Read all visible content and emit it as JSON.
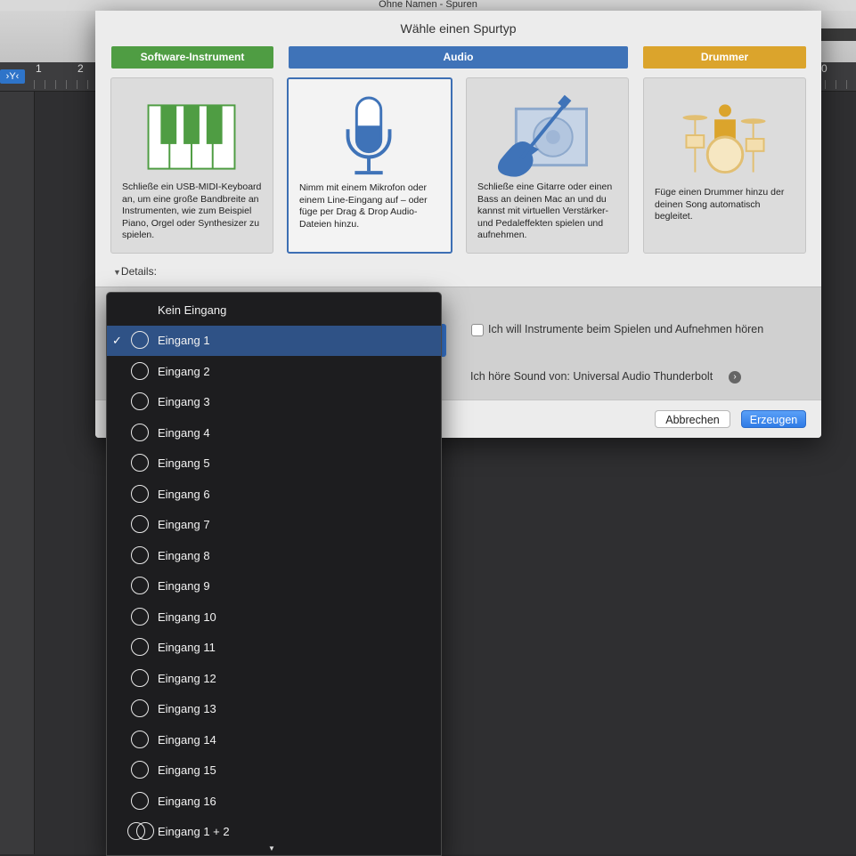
{
  "window": {
    "title": "Ohne Namen - Spuren"
  },
  "ruler": {
    "marks": [
      "1",
      "2",
      "0"
    ],
    "filter_button": "›Y‹"
  },
  "dialog": {
    "title": "Wähle einen Spurtyp",
    "categories": [
      {
        "label": "Software-Instrument",
        "color": "#4f9d43",
        "description": "Schließe ein USB-MIDI-Keyboard an, um eine große Bandbreite an Instrumenten, wie zum Beispiel Piano, Orgel oder Synthesizer zu spielen."
      },
      {
        "label": "Audio",
        "color": "#3f73b8",
        "description": "Nimm mit einem Mikrofon oder einem Line-Eingang auf – oder füge per Drag & Drop Audio-Dateien hinzu."
      },
      {
        "label": "",
        "color": "#3f73b8",
        "description": "Schließe eine Gitarre oder einen Bass an deinen Mac an und du kannst mit virtuellen Verstärker-und Pedaleffekten spielen und aufnehmen."
      },
      {
        "label": "Drummer",
        "color": "#dba42c",
        "description": "Füge einen Drummer hinzu der deinen Song automatisch begleitet."
      }
    ],
    "details_label": "Details:",
    "monitor_checkbox_label": "Ich will Instrumente beim Spielen und Aufnehmen hören",
    "monitor_checked": false,
    "sound_source_label": "Ich höre Sound von: Universal Audio Thunderbolt",
    "cancel_label": "Abbrechen",
    "create_label": "Erzeugen"
  },
  "input_menu": {
    "selected_index": 1,
    "items": [
      "Kein Eingang",
      "Eingang 1",
      "Eingang 2",
      "Eingang 3",
      "Eingang 4",
      "Eingang 5",
      "Eingang 6",
      "Eingang 7",
      "Eingang 8",
      "Eingang 9",
      "Eingang 10",
      "Eingang 11",
      "Eingang 12",
      "Eingang 13",
      "Eingang 14",
      "Eingang 15",
      "Eingang 16",
      "Eingang 1 + 2"
    ],
    "scroll_indicator": "▼"
  }
}
